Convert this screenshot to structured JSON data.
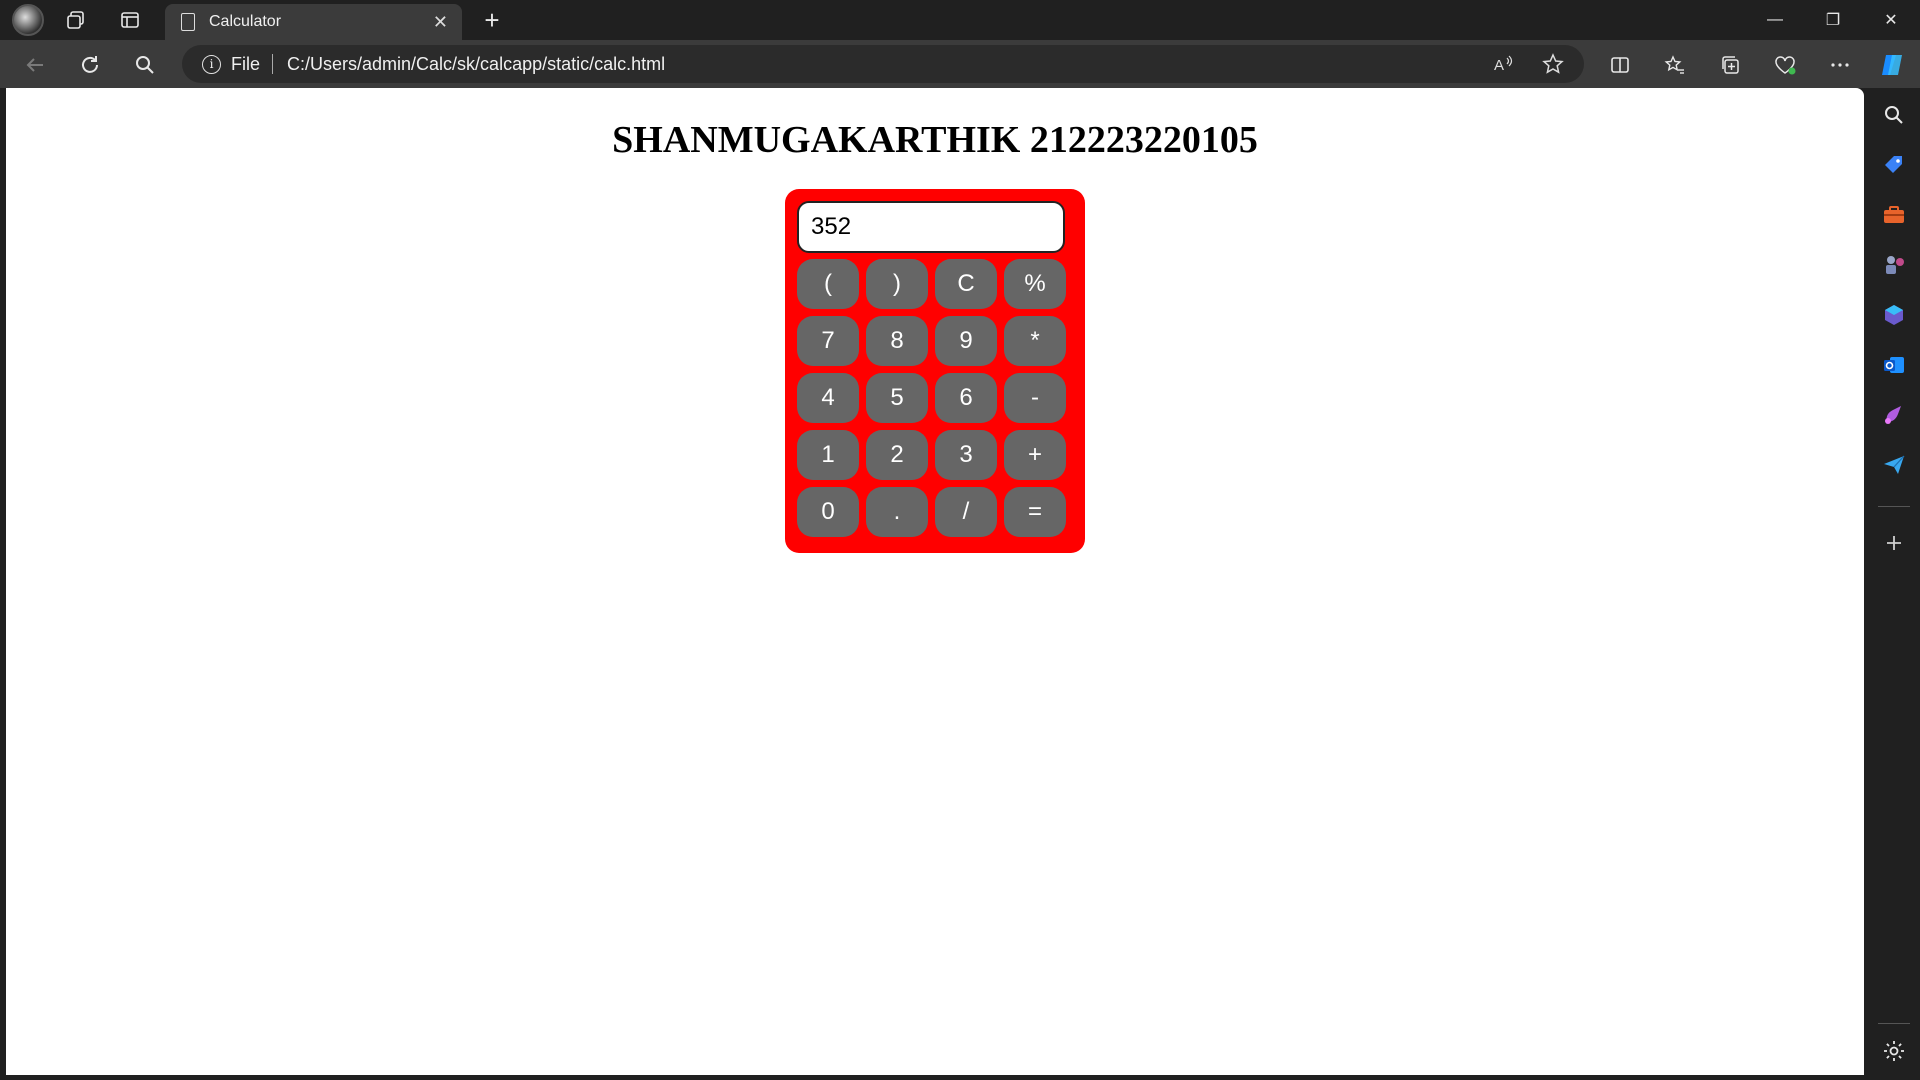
{
  "browser": {
    "tab_title": "Calculator",
    "tab_close": "✕",
    "new_tab": "+",
    "window_controls": [
      "—",
      "❐",
      "✕"
    ],
    "address_prefix": "File",
    "url": "C:/Users/admin/Calc/sk/calcapp/static/calc.html",
    "info_glyph": "i"
  },
  "page": {
    "heading": "SHANMUGAKARTHIK 212223220105"
  },
  "calculator": {
    "display_value": "352",
    "keys": [
      "(",
      ")",
      "C",
      "%",
      "7",
      "8",
      "9",
      "*",
      "4",
      "5",
      "6",
      "-",
      "1",
      "2",
      "3",
      "+",
      "0",
      ".",
      "/",
      "="
    ],
    "body_color": "#ff0000",
    "key_color": "#666666"
  }
}
